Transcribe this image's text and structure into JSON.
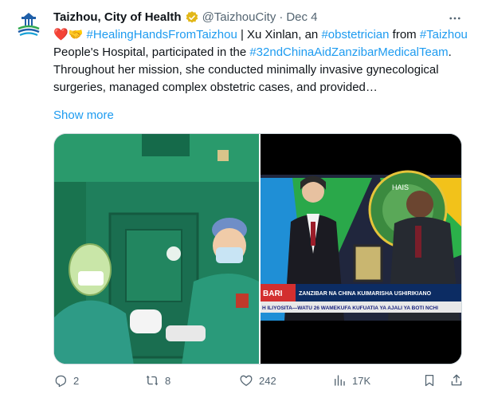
{
  "author": {
    "display_name": "Taizhou, City of Health",
    "handle": "@TaizhouCity",
    "separator": "·",
    "date": "Dec 4",
    "verified_badge": "gold-check-icon"
  },
  "post": {
    "emoji": "❤️🤝",
    "parts": [
      {
        "text": "#HealingHandsFromTaizhou",
        "hashtag": true
      },
      {
        "text": " | Xu Xinlan, an ",
        "hashtag": false
      },
      {
        "text": "#obstetrician",
        "hashtag": true
      },
      {
        "text": " from ",
        "hashtag": false
      },
      {
        "text": "#Taizhou",
        "hashtag": true
      },
      {
        "text": " People's Hospital, participated in the ",
        "hashtag": false
      },
      {
        "text": "#32ndChinaAidZanzibarMedicalTeam",
        "hashtag": true
      },
      {
        "text": ". Throughout her mission, she conducted minimally invasive gynecological surgeries, managed complex obstetric cases, and provided…",
        "hashtag": false
      }
    ],
    "show_more": "Show more"
  },
  "media": {
    "right_photo": {
      "banner_text": "ZANZIBAR NA CHINA KUIMARISHA USHIRIKIANO",
      "ticker_text": "H ILIYOSITA—WATU 26 WAMEKUFA KUFUATIA YA AJALI YA BOTI NCHI",
      "left_tag": "BARI",
      "logo_text": "HAIS"
    }
  },
  "actions": {
    "reply": {
      "count": "2",
      "icon": "reply-icon"
    },
    "repost": {
      "count": "8",
      "icon": "repost-icon"
    },
    "like": {
      "count": "242",
      "icon": "heart-icon"
    },
    "views": {
      "count": "17K",
      "icon": "views-icon"
    },
    "bookmark": {
      "icon": "bookmark-icon"
    },
    "share": {
      "icon": "share-icon"
    }
  },
  "colors": {
    "link": "#1d9bf0",
    "secondary_text": "#536471",
    "verified_gold": "#e2b719"
  }
}
